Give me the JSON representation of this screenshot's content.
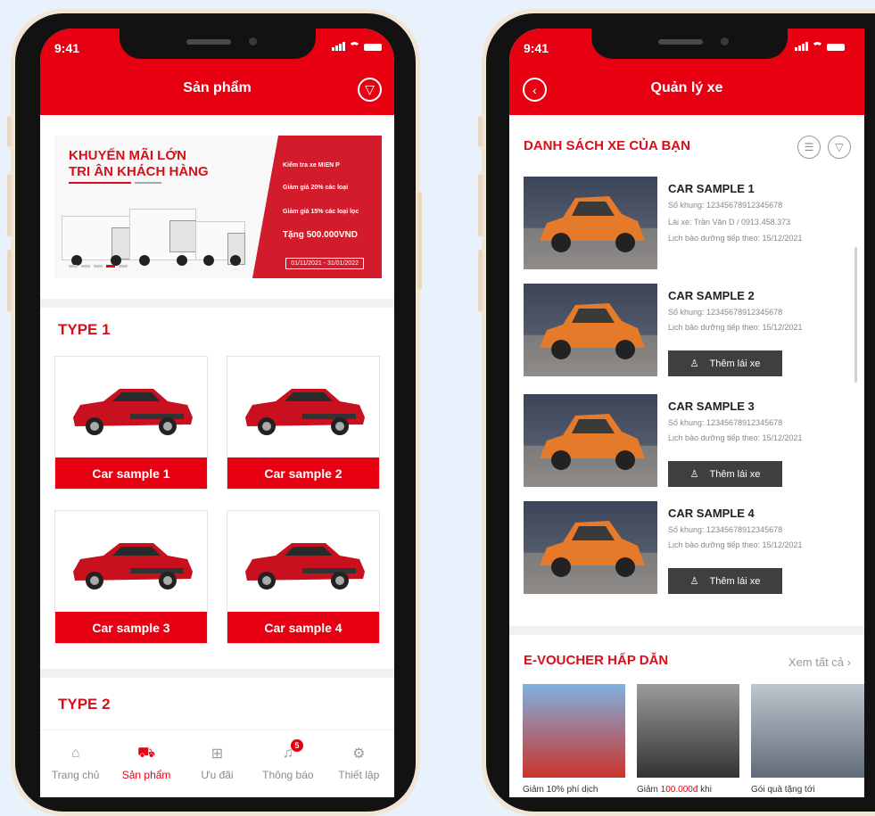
{
  "status": {
    "time": "9:41"
  },
  "screen1": {
    "title": "Sản phẩm",
    "banner": {
      "headline_1": "KHUYẾN MÃI LỚN",
      "headline_2": "TRI ÂN KHÁCH HÀNG",
      "promo_1": "Kiểm tra xe MIEN P",
      "promo_2": "Giảm giá 20% các loại",
      "promo_3": "Giảm giá 15% các loại lọc",
      "promo_4": "Tặng 500.000VND",
      "period": "01/11/2021 - 31/01/2022"
    },
    "sections": [
      {
        "title": "TYPE 1",
        "cards": [
          "Car sample 1",
          "Car sample 2",
          "Car sample 3",
          "Car sample 4"
        ]
      },
      {
        "title": "TYPE 2"
      }
    ],
    "tabs": [
      {
        "label": "Trang chủ",
        "icon": "home-icon"
      },
      {
        "label": "Sản phẩm",
        "icon": "truck-icon"
      },
      {
        "label": "Ưu đãi",
        "icon": "gift-icon"
      },
      {
        "label": "Thông báo",
        "icon": "bell-icon",
        "badge": "5"
      },
      {
        "label": "Thiết lập",
        "icon": "gear-icon"
      }
    ]
  },
  "screen2": {
    "title": "Quản lý xe",
    "list_title": "DANH SÁCH XE CỦA BẠN",
    "vehicles": [
      {
        "name": "CAR SAMPLE 1",
        "chassis": "Số khung: 12345678912345678",
        "driver": "Lái xe: Trần Văn D / 0913.458.373",
        "next": "Lịch bảo dưỡng tiếp theo: 15/12/2021"
      },
      {
        "name": "CAR SAMPLE 2",
        "chassis": "Số khung: 12345678912345678",
        "next": "Lịch bảo dưỡng tiếp theo: 15/12/2021",
        "button": "Thêm lái xe"
      },
      {
        "name": "CAR SAMPLE 3",
        "chassis": "Số khung: 12345678912345678",
        "next": "Lịch bảo dưỡng tiếp theo: 15/12/2021",
        "button": "Thêm lái xe"
      },
      {
        "name": "CAR SAMPLE 4",
        "chassis": "Số khung: 12345678912345678",
        "next": "Lịch bảo dưỡng tiếp theo: 15/12/2021",
        "button": "Thêm lái xe"
      }
    ],
    "voucher_title": "E-VOUCHER HẤP DẪN",
    "see_all": "Xem tất cả",
    "vouchers": [
      {
        "caption": "Giảm 10% phí dịch"
      },
      {
        "caption_pre": "Giảm ",
        "caption_red": "100.000đ",
        "caption_post": " khi"
      },
      {
        "caption": "Gói quà tặng tới"
      }
    ]
  },
  "colors": {
    "brand_red": "#e60012",
    "dark_button": "#3f3f3f",
    "background": "#e9f1fd"
  }
}
